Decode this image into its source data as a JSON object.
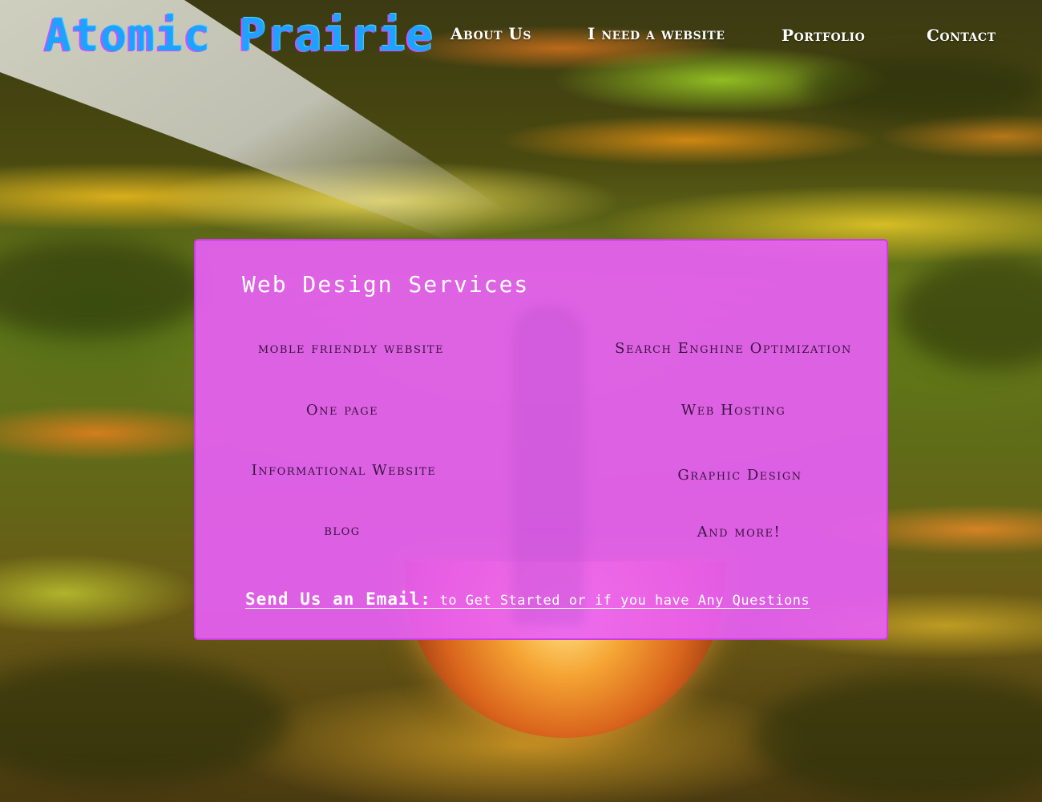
{
  "site": {
    "logo": "Atomic Prairie"
  },
  "nav": {
    "items": [
      {
        "label": "About Us"
      },
      {
        "label": "I need a website"
      },
      {
        "label": "Portfolio"
      },
      {
        "label": "Contact"
      }
    ]
  },
  "services_panel": {
    "title": "Web Design Services",
    "left_column": [
      "moble friendly website",
      "One page",
      "Informational Website",
      "blog"
    ],
    "right_column": [
      "Search Enghine Optimization",
      "Web Hosting",
      "Graphic Design",
      "And more!"
    ],
    "cta_strong": "Send Us an Email:",
    "cta_rest": " to Get Started or if you have Any Questions"
  },
  "colors": {
    "logo": "#1da3ff",
    "panel": "#ea5ffa",
    "service_text": "#3a1440",
    "nav_text": "#ffffff"
  }
}
